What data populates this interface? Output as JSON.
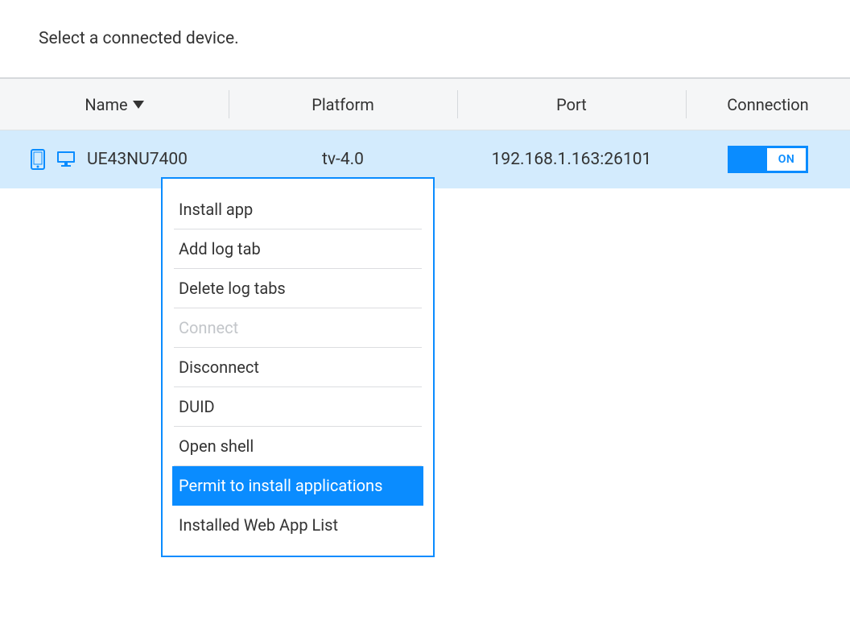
{
  "prompt": "Select a connected device.",
  "columns": {
    "name": "Name",
    "platform": "Platform",
    "port": "Port",
    "connection": "Connection"
  },
  "sort": {
    "column": "name",
    "direction": "desc"
  },
  "devices": [
    {
      "name": "UE43NU7400",
      "platform": "tv-4.0",
      "port": "192.168.1.163:26101",
      "connection": "ON"
    }
  ],
  "context_menu": {
    "items": [
      {
        "label": "Install app",
        "enabled": true,
        "selected": false
      },
      {
        "label": "Add log tab",
        "enabled": true,
        "selected": false
      },
      {
        "label": "Delete log tabs",
        "enabled": true,
        "selected": false
      },
      {
        "label": "Connect",
        "enabled": false,
        "selected": false
      },
      {
        "label": "Disconnect",
        "enabled": true,
        "selected": false
      },
      {
        "label": "DUID",
        "enabled": true,
        "selected": false
      },
      {
        "label": "Open shell",
        "enabled": true,
        "selected": false
      },
      {
        "label": "Permit to install applications",
        "enabled": true,
        "selected": true
      },
      {
        "label": "Installed Web App List",
        "enabled": true,
        "selected": false
      }
    ]
  },
  "colors": {
    "accent": "#0a8cff",
    "row_selected": "#d3ebfd",
    "header_bg": "#f5f6f7",
    "divider": "#d6d9dc",
    "disabled_text": "#c3c6ca"
  }
}
